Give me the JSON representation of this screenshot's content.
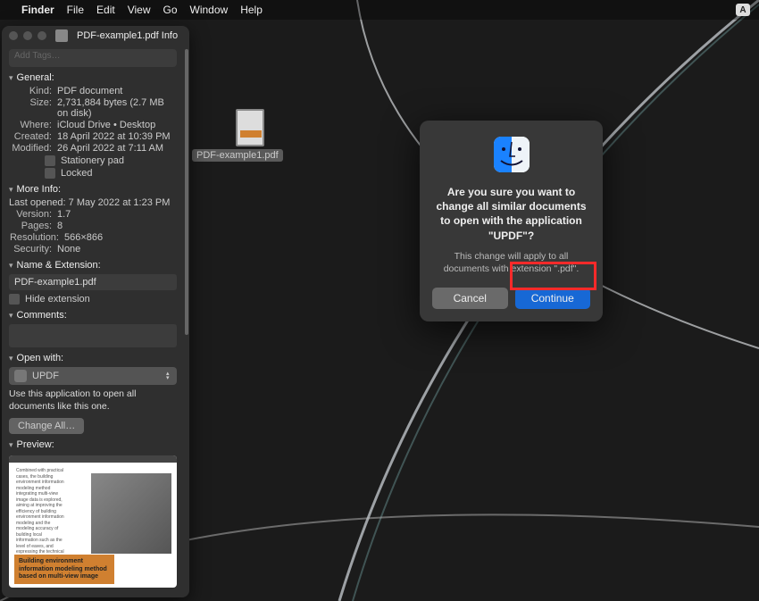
{
  "menubar": {
    "app": "Finder",
    "items": [
      "File",
      "Edit",
      "View",
      "Go",
      "Window",
      "Help"
    ],
    "input_badge": "A"
  },
  "desktop": {
    "file_label": "PDF-example1.pdf"
  },
  "info": {
    "window_title": "PDF-example1.pdf Info",
    "tags_placeholder": "Add Tags…",
    "sections": {
      "general": {
        "header": "General:",
        "kind_k": "Kind:",
        "kind_v": "PDF document",
        "size_k": "Size:",
        "size_v": "2,731,884 bytes (2.7 MB on disk)",
        "where_k": "Where:",
        "where_v": "iCloud Drive • Desktop",
        "created_k": "Created:",
        "created_v": "18 April 2022 at 10:39 PM",
        "modified_k": "Modified:",
        "modified_v": "26 April 2022 at 7:11 AM",
        "stationery": "Stationery pad",
        "locked": "Locked"
      },
      "moreinfo": {
        "header": "More Info:",
        "lastopened": "Last opened: 7 May 2022 at 1:23 PM",
        "version_k": "Version:",
        "version_v": "1.7",
        "pages_k": "Pages:",
        "pages_v": "8",
        "resolution_k": "Resolution:",
        "resolution_v": "566×866",
        "security_k": "Security:",
        "security_v": "None"
      },
      "nameext": {
        "header": "Name & Extension:",
        "filename": "PDF-example1.pdf",
        "hideext": "Hide extension"
      },
      "comments": {
        "header": "Comments:"
      },
      "openwith": {
        "header": "Open with:",
        "app": "UPDF",
        "help": "Use this application to open all documents like this one.",
        "changeall": "Change All…"
      },
      "preview": {
        "header": "Preview:",
        "banner": "Building environment information modeling method based on multi-view image"
      }
    }
  },
  "dialog": {
    "title": "Are you sure you want to change all similar documents to open with the application \"UPDF\"?",
    "sub": "This change will apply to all documents with extension \".pdf\".",
    "cancel": "Cancel",
    "continue": "Continue"
  }
}
